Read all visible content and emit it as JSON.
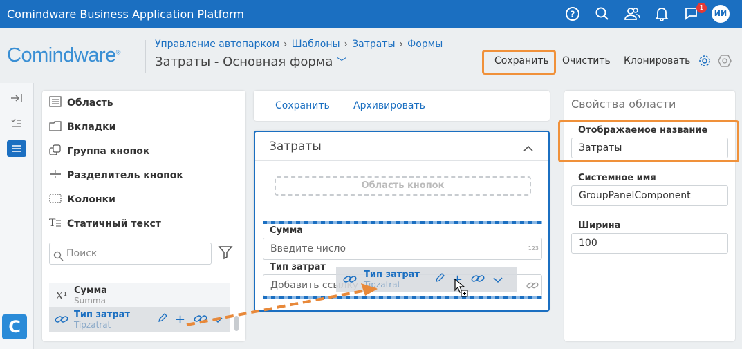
{
  "topbar": {
    "app_title": "Comindware Business Application Platform",
    "notification_count": "1",
    "avatar_initials": "ИИ",
    "icons": [
      "help-icon",
      "search-icon",
      "users-icon",
      "bell-icon",
      "flag-icon"
    ]
  },
  "header": {
    "logo": "Comindware",
    "logo_mark": "®",
    "breadcrumb": [
      "Управление автопарком",
      "Шаблоны",
      "Затраты",
      "Формы"
    ],
    "title": "Затраты - Основная форма",
    "buttons": {
      "save": "Сохранить",
      "clear": "Очистить",
      "clone": "Клонировать"
    }
  },
  "components": {
    "items": [
      {
        "label": "Область",
        "icon": "area-icon"
      },
      {
        "label": "Вкладки",
        "icon": "tabs-icon"
      },
      {
        "label": "Группа кнопок",
        "icon": "button-group-icon"
      },
      {
        "label": "Разделитель кнопок",
        "icon": "button-divider-icon"
      },
      {
        "label": "Колонки",
        "icon": "columns-icon"
      },
      {
        "label": "Статичный текст",
        "icon": "static-text-icon"
      }
    ],
    "search_placeholder": "Поиск",
    "attributes": [
      {
        "name": "Сумма",
        "system": "Summa",
        "icon_text": "X¹"
      },
      {
        "name": "Тип затрат",
        "system": "Tipzatrat"
      }
    ]
  },
  "form": {
    "toolbar": {
      "save": "Сохранить",
      "archive": "Архивировать"
    },
    "panel_title": "Затраты",
    "buttons_area": "Область кнопок",
    "fields": [
      {
        "label": "Сумма",
        "placeholder": "Введите число",
        "suffix": "123"
      },
      {
        "label": "Тип затрат",
        "placeholder": "Добавить ссылку"
      }
    ],
    "drag_ghost": {
      "name": "Тип затрат",
      "system": "Tipzatrat"
    }
  },
  "properties": {
    "title": "Свойства области",
    "display_name_label": "Отображаемое название",
    "display_name_value": "Затраты",
    "system_name_label": "Системное имя",
    "system_name_value": "GroupPanelComponent",
    "width_label": "Ширина",
    "width_value": "100"
  },
  "colors": {
    "accent": "#1b6fc1",
    "highlight": "#f0913a",
    "arrow": "#e8893a"
  }
}
